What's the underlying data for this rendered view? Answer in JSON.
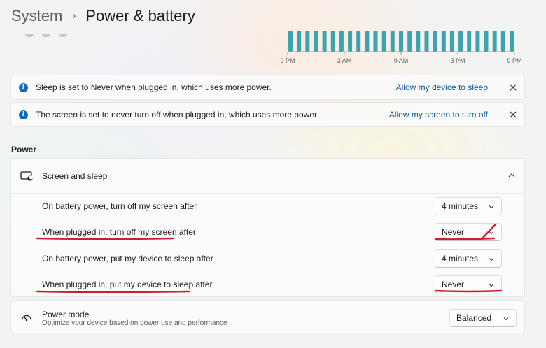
{
  "breadcrumb": {
    "parent": "System",
    "separator": "›",
    "current": "Power & battery"
  },
  "usage_chart": {
    "time_labels": [
      "9 PM",
      "3 AM",
      "9 AM",
      "3 PM",
      "9 PM"
    ],
    "bar_count": 27,
    "bar_color": "#3fa3ad"
  },
  "info_bars": [
    {
      "text": "Sleep is set to Never when plugged in, which uses more power.",
      "link": "Allow my device to sleep"
    },
    {
      "text": "The screen is set to never turn off when plugged in, which uses more power.",
      "link": "Allow my screen to turn off"
    }
  ],
  "section_title": "Power",
  "screen_sleep": {
    "title": "Screen and sleep",
    "settings": [
      {
        "label": "On battery power, turn off my screen after",
        "value": "4 minutes"
      },
      {
        "label": "When plugged in, turn off my screen after",
        "value": "Never"
      },
      {
        "label": "On battery power, put my device to sleep after",
        "value": "4 minutes"
      },
      {
        "label": "When plugged in, put my device to sleep after",
        "value": "Never"
      }
    ]
  },
  "power_mode": {
    "title": "Power mode",
    "description": "Optimize your device based on power use and performance",
    "value": "Balanced"
  },
  "colors": {
    "accent": "#0f6cbd",
    "link": "#0a57a0",
    "annotation": "#cc1f2d"
  }
}
